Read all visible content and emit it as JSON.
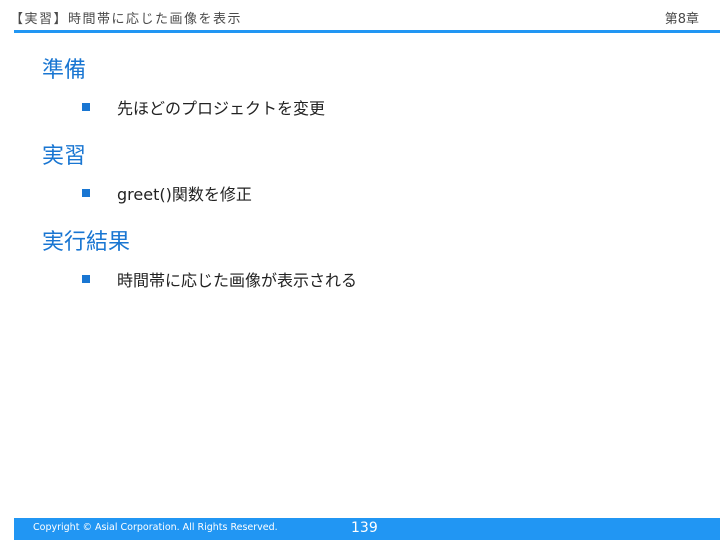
{
  "header": {
    "title": "【実習】時間帯に応じた画像を表示",
    "chapter": "第8章"
  },
  "sections": [
    {
      "heading": "準備",
      "bullets": [
        "先ほどのプロジェクトを変更"
      ]
    },
    {
      "heading": "実習",
      "bullets": [
        "greet()関数を修正"
      ]
    },
    {
      "heading": "実行結果",
      "bullets": [
        "時間帯に応じた画像が表示される"
      ]
    }
  ],
  "footer": {
    "copyright": "Copyright © Asial Corporation. All Rights Reserved.",
    "page_number": "139"
  },
  "colors": {
    "accent": "#2196f3",
    "heading": "#1976d2"
  }
}
